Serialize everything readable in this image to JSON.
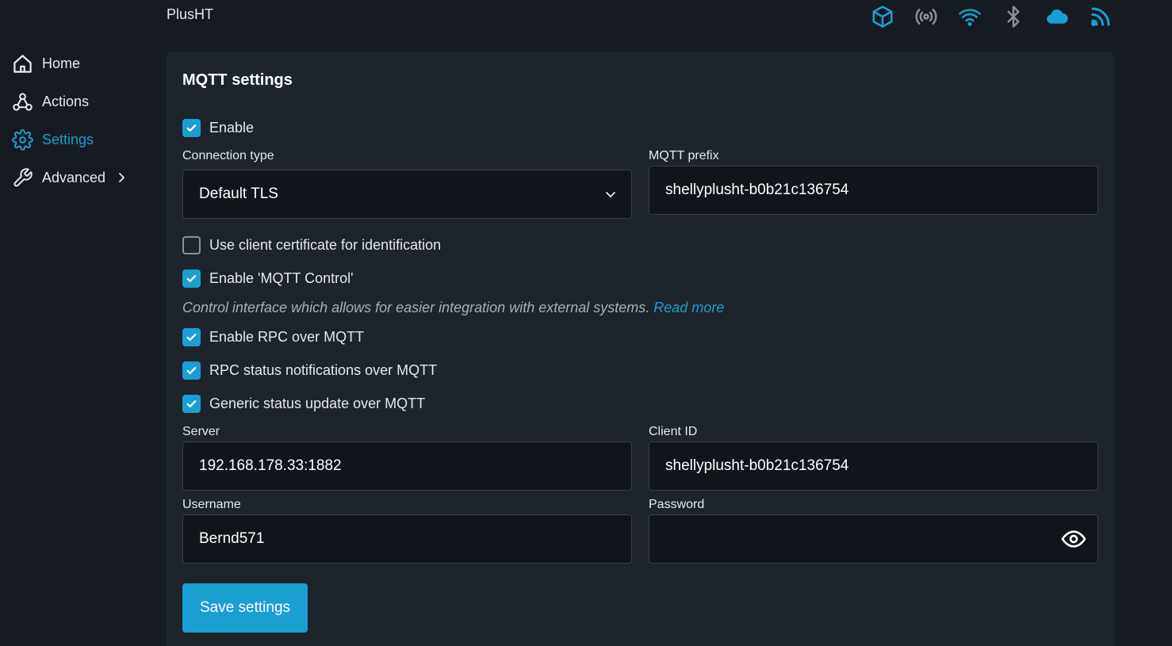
{
  "header": {
    "device_name": "PlusHT",
    "status_icons": [
      "cube-icon",
      "broadcast-icon",
      "wifi-icon",
      "bluetooth-icon",
      "cloud-icon",
      "rss-icon"
    ],
    "accent_color": "#1a9fd1"
  },
  "sidebar": {
    "items": [
      {
        "label": "Home",
        "icon": "home-icon"
      },
      {
        "label": "Actions",
        "icon": "webhook-icon"
      },
      {
        "label": "Settings",
        "icon": "gear-icon",
        "active": true
      },
      {
        "label": "Advanced",
        "icon": "wrench-icon",
        "expandable": true
      }
    ]
  },
  "mqtt": {
    "title": "MQTT settings",
    "enable": {
      "label": "Enable",
      "checked": true
    },
    "connection_type": {
      "label": "Connection type",
      "value": "Default TLS"
    },
    "prefix": {
      "label": "MQTT prefix",
      "value": "shellyplusht-b0b21c136754"
    },
    "client_cert": {
      "label": "Use client certificate for identification",
      "checked": false
    },
    "mqtt_control": {
      "label": "Enable 'MQTT Control'",
      "checked": true
    },
    "hint": {
      "text": "Control interface which allows for easier integration with external systems.",
      "link": "Read more"
    },
    "rpc": {
      "label": "Enable RPC over MQTT",
      "checked": true
    },
    "rpc_status": {
      "label": "RPC status notifications over MQTT",
      "checked": true
    },
    "generic_status": {
      "label": "Generic status update over MQTT",
      "checked": true
    },
    "server": {
      "label": "Server",
      "value": "192.168.178.33:1882"
    },
    "client_id": {
      "label": "Client ID",
      "value": "shellyplusht-b0b21c136754"
    },
    "username": {
      "label": "Username",
      "value": "Bernd571"
    },
    "password": {
      "label": "Password",
      "value": ""
    },
    "save_label": "Save settings"
  }
}
